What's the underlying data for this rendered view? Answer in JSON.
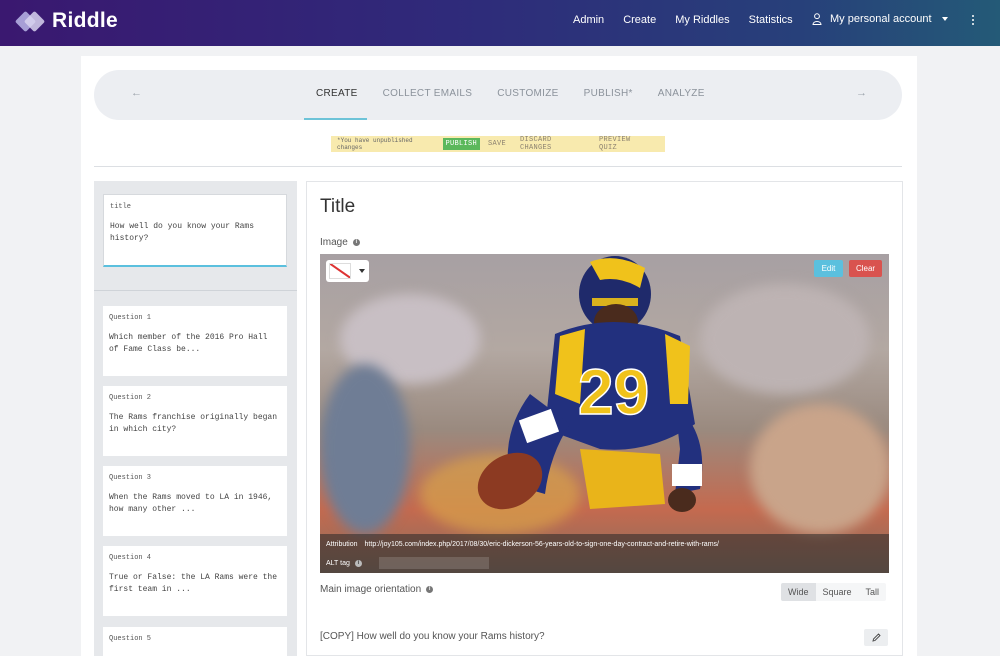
{
  "app": {
    "name": "Riddle"
  },
  "nav": {
    "links": [
      "Admin",
      "Create",
      "My Riddles",
      "Statistics"
    ],
    "account_label": "My personal account"
  },
  "steps": {
    "prev_icon": "arrow-left-icon",
    "next_icon": "arrow-right-icon",
    "items": [
      "CREATE",
      "COLLECT EMAILS",
      "CUSTOMIZE",
      "PUBLISH*",
      "ANALYZE"
    ],
    "active": "CREATE"
  },
  "notice": {
    "text": "*You have unpublished changes",
    "publish": "PUBLISH",
    "save": "SAVE",
    "discard": "DISCARD CHANGES",
    "preview": "PREVIEW QUIZ"
  },
  "sidebar": {
    "title_card": {
      "label": "title",
      "text": "How well do you know your Rams history?"
    },
    "questions": [
      {
        "label": "Question 1",
        "text": "Which member of the 2016 Pro Hall of Fame Class be..."
      },
      {
        "label": "Question 2",
        "text": "The Rams franchise originally began in which city?"
      },
      {
        "label": "Question 3",
        "text": "When the Rams moved to LA in 1946, how many other ..."
      },
      {
        "label": "Question 4",
        "text": "True or False: the LA Rams were the first team in ..."
      },
      {
        "label": "Question 5",
        "text": ""
      }
    ]
  },
  "editor": {
    "title": "Title",
    "image_label": "Image",
    "edit": "Edit",
    "clear": "Clear",
    "attribution_label": "Attribution",
    "attribution_url": "http://joy105.com/index.php/2017/08/30/eric-dickerson-56-years-old-to-sign-one-day-contract-and-retire-with-rams/",
    "alt_label": "ALT tag",
    "jersey_number": "29",
    "orientation_label": "Main image orientation",
    "orientation_options": [
      "Wide",
      "Square",
      "Tall"
    ],
    "orientation_selected": "Wide",
    "copy_text": "[COPY] How well do you know your Rams history?"
  },
  "colors": {
    "accent": "#5bc0de",
    "publish_green": "#5cb85c",
    "clear_red": "#d9534f",
    "notice_bg": "#f8eaae"
  }
}
